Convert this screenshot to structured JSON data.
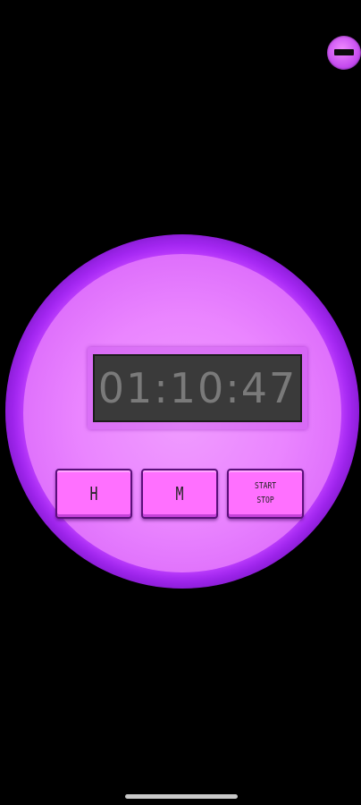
{
  "timer": {
    "display": "01:10:47"
  },
  "buttons": {
    "hours": "H",
    "minutes": "M",
    "start": "START",
    "stop": "STOP"
  },
  "colors": {
    "background": "#000000",
    "ring": "#b532ff",
    "face": "#ea85ff",
    "button": "#ff70ff",
    "lcd": "#3a3a3a",
    "lcd_text": "#7a7a7a"
  }
}
